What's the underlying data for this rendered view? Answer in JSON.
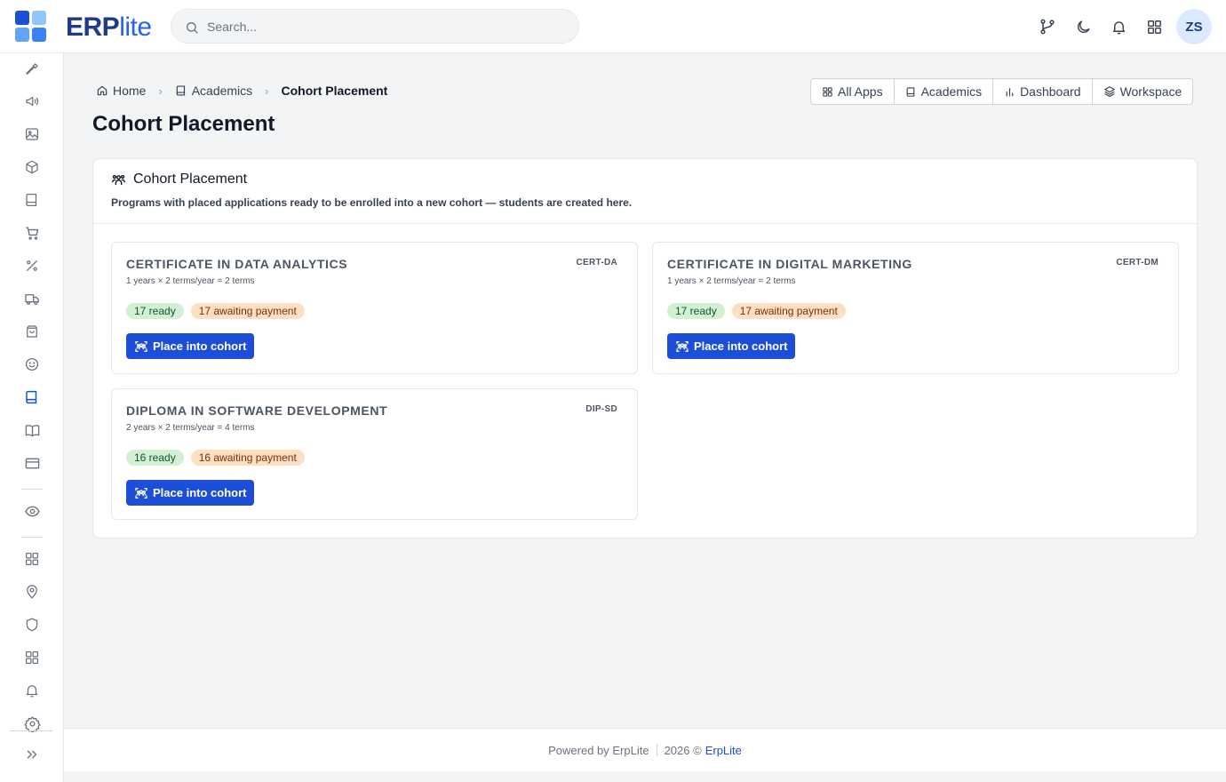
{
  "brand": {
    "name_main": "ERP",
    "name_suffix": "lite",
    "colors": [
      "#1d4ed8",
      "#93c5fd",
      "#3b82f6",
      "#60a5fa"
    ]
  },
  "search": {
    "placeholder": "Search..."
  },
  "header_icons": [
    "git-branch-icon",
    "moon-icon",
    "bell-icon",
    "apps-grid-icon"
  ],
  "user": {
    "initials": "ZS"
  },
  "sidebar": {
    "icons": [
      "tools-icon",
      "megaphone-icon",
      "image-icon",
      "box-icon",
      "book-icon",
      "cart-icon",
      "percent-icon",
      "truck-icon",
      "shopping-bag-icon",
      "smile-icon",
      "academics-book-icon",
      "open-book-icon",
      "credit-card-icon",
      "eye-icon",
      "grid-icon",
      "map-pin-icon",
      "shield-icon",
      "apps-icon",
      "bell-icon",
      "settings-icon",
      "expand-icon"
    ],
    "active": "academics-book-icon"
  },
  "breadcrumb": {
    "home": "Home",
    "academics": "Academics",
    "current": "Cohort Placement",
    "separator": "›"
  },
  "page": {
    "title": "Cohort Placement"
  },
  "appnav": {
    "all_apps": "All Apps",
    "academics": "Academics",
    "dashboard": "Dashboard",
    "workspace": "Workspace"
  },
  "panel": {
    "title": "Cohort Placement",
    "subtitle": "Programs with placed applications ready to be enrolled into a new cohort — students are created here."
  },
  "programs": [
    {
      "name": "CERTIFICATE IN DATA ANALYTICS",
      "code": "CERT-DA",
      "duration": "1 years × 2 terms/year = 2 terms",
      "ready": "17 ready",
      "awaiting": "17 awaiting payment",
      "action": "Place into cohort"
    },
    {
      "name": "CERTIFICATE IN DIGITAL MARKETING",
      "code": "CERT-DM",
      "duration": "1 years × 2 terms/year = 2 terms",
      "ready": "17 ready",
      "awaiting": "17 awaiting payment",
      "action": "Place into cohort"
    },
    {
      "name": "DIPLOMA IN SOFTWARE DEVELOPMENT",
      "code": "DIP-SD",
      "duration": "2 years × 2 terms/year = 4 terms",
      "ready": "16 ready",
      "awaiting": "16 awaiting payment",
      "action": "Place into cohort"
    }
  ],
  "footer": {
    "powered": "Powered by ErpLite",
    "copyright": "2026 ©",
    "link": "ErpLite"
  }
}
